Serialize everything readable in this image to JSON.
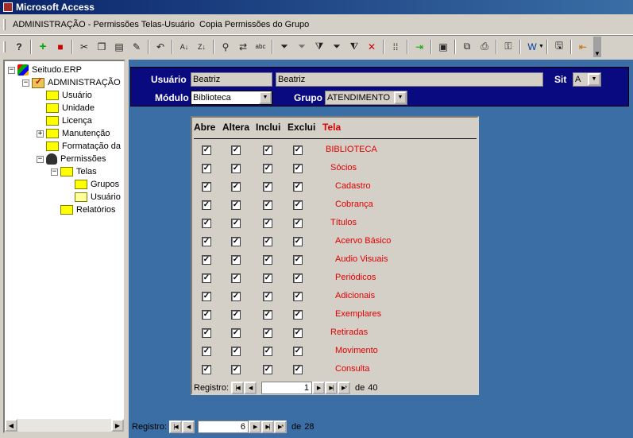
{
  "window": {
    "title": "Microsoft Access"
  },
  "menubar": {
    "items": [
      "ADMINISTRAÇÃO - Permissões Telas-Usuário",
      "Copia Permissões do Grupo"
    ]
  },
  "toolbar": {
    "buttons": [
      "help-icon",
      "add-icon",
      "delete-icon",
      "cut-icon",
      "copy-icon",
      "paste-icon",
      "format-painter-icon",
      "undo-icon",
      "sort-asc-icon",
      "sort-desc-icon",
      "find-icon",
      "replace-icon",
      "spelling-icon",
      "filter-selection-icon",
      "filter-form-icon",
      "apply-filter-icon",
      "toggle-filter-icon",
      "advanced-filter-icon",
      "remove-filter-icon",
      "grid-icon",
      "import-icon",
      "form-view-icon",
      "print-preview-icon",
      "print-icon",
      "key-icon",
      "office-links-icon",
      "save-icon",
      "exit-icon"
    ]
  },
  "tree": {
    "items": [
      {
        "label": "Seitudo.ERP",
        "level": 0,
        "expander": "−",
        "icon": "root-icon"
      },
      {
        "label": "ADMINISTRAÇÃO",
        "level": 1,
        "expander": "−",
        "icon": "admin-icon"
      },
      {
        "label": "Usuário",
        "level": 2,
        "expander": "",
        "icon": "folder-icon"
      },
      {
        "label": "Unidade",
        "level": 2,
        "expander": "",
        "icon": "folder-icon"
      },
      {
        "label": "Licença",
        "level": 2,
        "expander": "",
        "icon": "folder-icon"
      },
      {
        "label": "Manutenção",
        "level": 2,
        "expander": "+",
        "icon": "folder-icon"
      },
      {
        "label": "Formatação da",
        "level": 2,
        "expander": "",
        "icon": "folder-icon"
      },
      {
        "label": "Permissões",
        "level": 2,
        "expander": "−",
        "icon": "perm-icon"
      },
      {
        "label": "Telas",
        "level": 3,
        "expander": "−",
        "icon": "folder-icon"
      },
      {
        "label": "Grupos",
        "level": 4,
        "expander": "",
        "icon": "folder-icon"
      },
      {
        "label": "Usuário",
        "level": 4,
        "expander": "",
        "icon": "open-folder-icon"
      },
      {
        "label": "Relatórios",
        "level": 3,
        "expander": "",
        "icon": "folder-icon"
      }
    ]
  },
  "header": {
    "usuario_label": "Usuário",
    "usuario_code": "Beatriz",
    "usuario_name": "Beatriz",
    "sit_label": "Sit",
    "sit_value": "A",
    "modulo_label": "Módulo",
    "modulo_value": "Biblioteca",
    "grupo_label": "Grupo",
    "grupo_value": "ATENDIMENTO"
  },
  "subform": {
    "columns": {
      "abre": "Abre",
      "altera": "Altera",
      "inclui": "Inclui",
      "exclui": "Exclui",
      "tela": "Tela"
    },
    "check_mark": "✓",
    "rows": [
      {
        "tela": "BIBLIOTECA",
        "indent": 0,
        "abre": true,
        "altera": true,
        "inclui": true,
        "exclui": true
      },
      {
        "tela": "Sócios",
        "indent": 1,
        "abre": true,
        "altera": true,
        "inclui": true,
        "exclui": true
      },
      {
        "tela": "Cadastro",
        "indent": 2,
        "abre": true,
        "altera": true,
        "inclui": true,
        "exclui": true
      },
      {
        "tela": "Cobrança",
        "indent": 2,
        "abre": true,
        "altera": true,
        "inclui": true,
        "exclui": true
      },
      {
        "tela": "Títulos",
        "indent": 1,
        "abre": true,
        "altera": true,
        "inclui": true,
        "exclui": true
      },
      {
        "tela": "Acervo Básico",
        "indent": 2,
        "abre": true,
        "altera": true,
        "inclui": true,
        "exclui": true
      },
      {
        "tela": "Audio Visuais",
        "indent": 2,
        "abre": true,
        "altera": true,
        "inclui": true,
        "exclui": true
      },
      {
        "tela": "Periódicos",
        "indent": 2,
        "abre": true,
        "altera": true,
        "inclui": true,
        "exclui": true
      },
      {
        "tela": "Adicionais",
        "indent": 2,
        "abre": true,
        "altera": true,
        "inclui": true,
        "exclui": true
      },
      {
        "tela": "Exemplares",
        "indent": 2,
        "abre": true,
        "altera": true,
        "inclui": true,
        "exclui": true
      },
      {
        "tela": "Retiradas",
        "indent": 1,
        "abre": true,
        "altera": true,
        "inclui": true,
        "exclui": true
      },
      {
        "tela": "Movimento",
        "indent": 2,
        "abre": true,
        "altera": true,
        "inclui": true,
        "exclui": true
      },
      {
        "tela": "Consulta",
        "indent": 2,
        "abre": true,
        "altera": true,
        "inclui": true,
        "exclui": true
      }
    ],
    "nav": {
      "label": "Registro:",
      "current": "1",
      "of": "de",
      "total": "40"
    }
  },
  "main_nav": {
    "label": "Registro:",
    "current": "6",
    "of": "de",
    "total": "28"
  },
  "colors": {
    "header_band": "#0a0a80",
    "workspace": "#3a6ea5",
    "tela_text": "#e00000"
  }
}
